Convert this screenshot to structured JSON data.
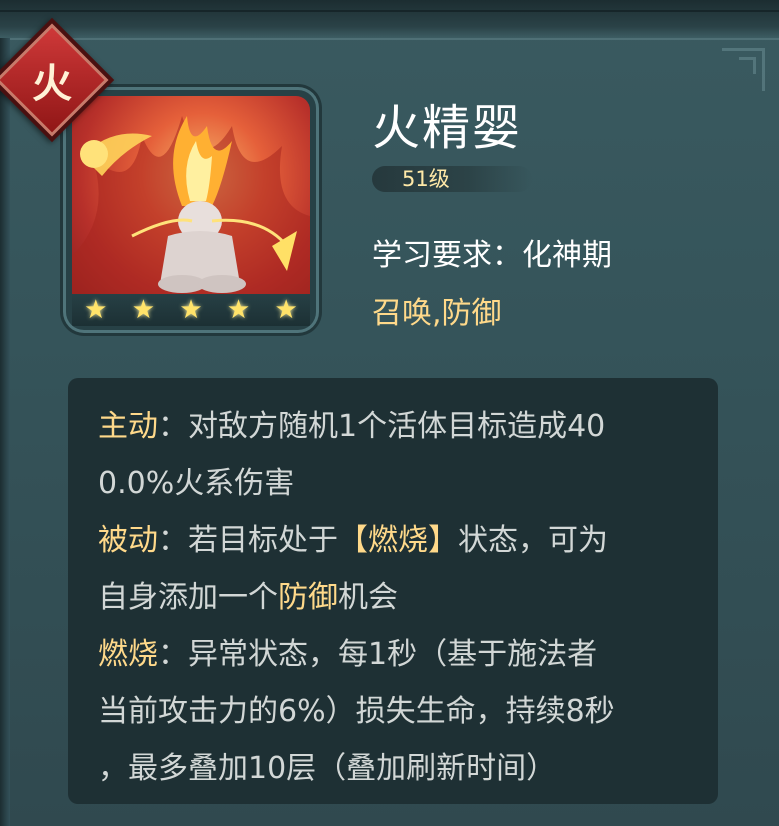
{
  "element": {
    "char": "火"
  },
  "creature": {
    "name": "火精婴",
    "level": "51级",
    "stars": 5,
    "requirement_label": "学习要求",
    "requirement_value": "化神期",
    "tags": "召唤,防御"
  },
  "description": {
    "active_label": "主动",
    "active_line1": "对敌方随机1个活体目标造成40",
    "active_line2": "0.0%火系伤害",
    "passive_label": "被动",
    "passive_text1": "若目标处于",
    "passive_keyword": "【燃烧】",
    "passive_text2": "状态，可为",
    "passive_line2_a": "自身添加一个",
    "passive_line2_keyword": "防御",
    "passive_line2_b": "机会",
    "burn_label": "燃烧",
    "burn_line1": "异常状态，每1秒（基于施法者",
    "burn_line2": "当前攻击力的6%）损失生命，持续8秒",
    "burn_line3": "，最多叠加10层（叠加刷新时间）"
  },
  "colors": {
    "accent_gold": "#ffd98a",
    "element_red": "#c42a2a",
    "star": "#ffe36a"
  }
}
